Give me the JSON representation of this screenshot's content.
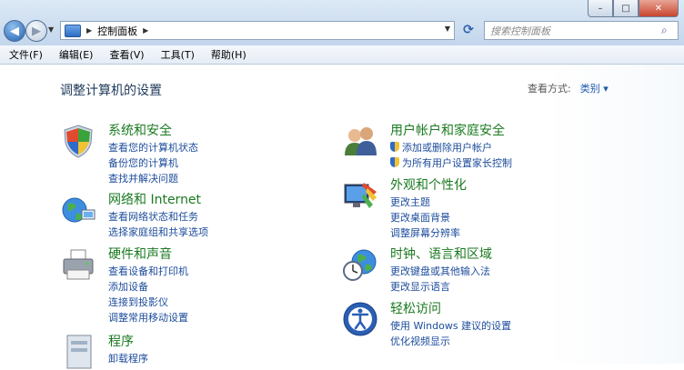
{
  "titlebar": {
    "minimize": "–",
    "maximize": "□",
    "close": "✕"
  },
  "address": {
    "crumb": "控制面板"
  },
  "search": {
    "placeholder": "搜索控制面板"
  },
  "menu": [
    "文件(F)",
    "编辑(E)",
    "查看(V)",
    "工具(T)",
    "帮助(H)"
  ],
  "page": {
    "title": "调整计算机的设置",
    "viewby_label": "查看方式:",
    "viewby_value": "类别 ▾"
  },
  "categories": [
    {
      "title": "系统和安全",
      "icon": "shield-icon",
      "links": [
        "查看您的计算机状态",
        "备份您的计算机",
        "查找并解决问题"
      ]
    },
    {
      "title": "网络和 Internet",
      "icon": "network-globe-icon",
      "links": [
        "查看网络状态和任务",
        "选择家庭组和共享选项"
      ]
    },
    {
      "title": "硬件和声音",
      "icon": "printer-icon",
      "links": [
        "查看设备和打印机",
        "添加设备",
        "连接到投影仪",
        "调整常用移动设置"
      ]
    },
    {
      "title": "程序",
      "icon": "programs-icon",
      "links": [
        "卸载程序"
      ]
    },
    {
      "title": "用户帐户和家庭安全",
      "icon": "users-icon",
      "links": [
        "添加或删除用户帐户",
        "为所有用户设置家长控制"
      ]
    },
    {
      "title": "外观和个性化",
      "icon": "appearance-icon",
      "links": [
        "更改主题",
        "更改桌面背景",
        "调整屏幕分辨率"
      ]
    },
    {
      "title": "时钟、语言和区域",
      "icon": "clock-globe-icon",
      "links": [
        "更改键盘或其他输入法",
        "更改显示语言"
      ]
    },
    {
      "title": "轻松访问",
      "icon": "ease-of-access-icon",
      "links": [
        "使用 Windows 建议的设置",
        "优化视频显示"
      ]
    }
  ]
}
